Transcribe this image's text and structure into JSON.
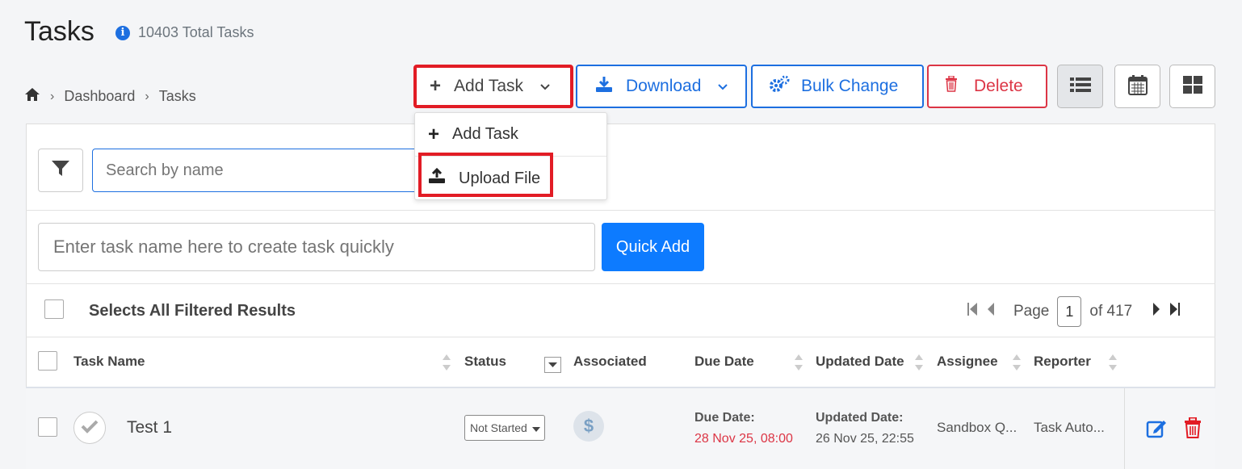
{
  "page": {
    "title": "Tasks",
    "total": "10403 Total Tasks"
  },
  "breadcrumb": [
    "Dashboard",
    "Tasks"
  ],
  "toolbar": {
    "add_task": "Add Task",
    "download": "Download",
    "bulk_change": "Bulk Change",
    "delete": "Delete"
  },
  "dropdown": {
    "items": [
      "Add Task",
      "Upload File"
    ]
  },
  "search": {
    "placeholder": "Search by name"
  },
  "quick_add": {
    "placeholder": "Enter task name here to create task quickly",
    "button": "Quick Add"
  },
  "select_all": "Selects All Filtered Results",
  "pager": {
    "label": "Page",
    "current": "1",
    "of": "of 417"
  },
  "columns": [
    "Task Name",
    "Status",
    "Associated",
    "Due Date",
    "Updated Date",
    "Assignee",
    "Reporter"
  ],
  "rows": [
    {
      "name": "Test 1",
      "status": "Not Started",
      "due_label": "Due Date:",
      "due": "28 Nov 25, 08:00",
      "updated_label": "Updated Date:",
      "updated": "26 Nov 25, 22:55",
      "assignee": "Sandbox Q...",
      "reporter": "Task Auto..."
    }
  ],
  "colors": {
    "primary": "#1d6fe0",
    "danger": "#dc3545",
    "highlight": "#e21c25",
    "overdue": "#dc3545"
  }
}
